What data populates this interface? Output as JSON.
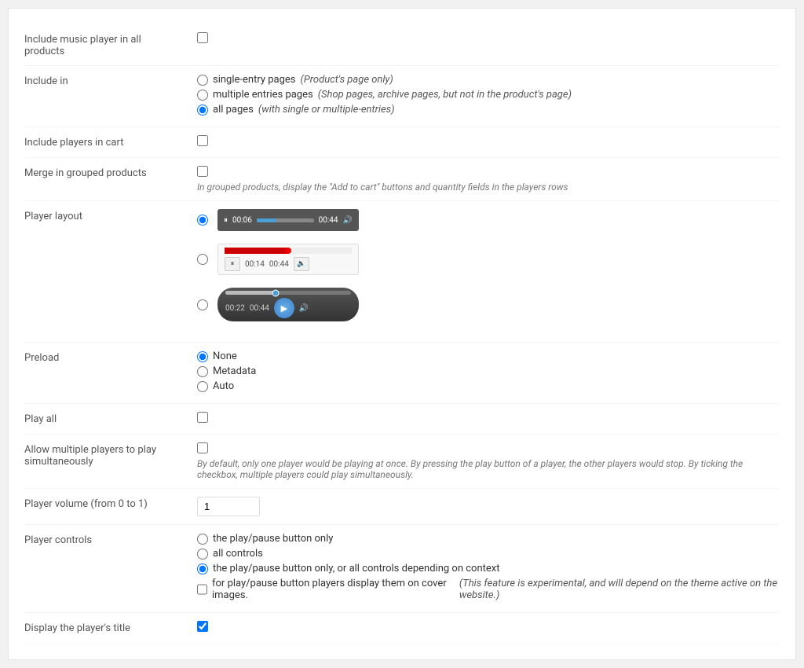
{
  "rows": {
    "include_music_player": {
      "label": "Include music player in all products"
    },
    "include_in": {
      "label": "Include in",
      "options": [
        {
          "id": "single-entry",
          "label": "single-entry pages ",
          "italic": "(Product's page only)",
          "checked": false
        },
        {
          "id": "multiple-entries",
          "label": "multiple entries pages ",
          "italic": "(Shop pages, archive pages, but not in the product's page)",
          "checked": false
        },
        {
          "id": "all-pages",
          "label": "all pages ",
          "italic": "(with single or multiple-entries)",
          "checked": true
        }
      ]
    },
    "include_players_in_cart": {
      "label": "Include players in cart"
    },
    "merge_in_grouped": {
      "label": "Merge in grouped products",
      "hint": "In grouped products, display the \"Add to cart\" buttons and quantity fields in the players rows"
    },
    "player_layout": {
      "label": "Player layout",
      "players": [
        {
          "selected": true,
          "type": "dark-bar",
          "time1": "00:06",
          "time2": "00:44"
        },
        {
          "selected": false,
          "type": "light-bar",
          "time1": "00:14",
          "time2": "00:44"
        },
        {
          "selected": false,
          "type": "rounded-dark",
          "time1": "00:22",
          "time2": "00:44"
        }
      ]
    },
    "preload": {
      "label": "Preload",
      "options": [
        {
          "id": "none",
          "label": "None",
          "checked": true
        },
        {
          "id": "metadata",
          "label": "Metadata",
          "checked": false
        },
        {
          "id": "auto",
          "label": "Auto",
          "checked": false
        }
      ]
    },
    "play_all": {
      "label": "Play all"
    },
    "allow_multiple": {
      "label": "Allow multiple players to play simultaneously",
      "hint": "By default, only one player would be playing at once. By pressing the play button of a player, the other players would stop. By ticking the checkbox, multiple players could play simultaneously."
    },
    "player_volume": {
      "label": "Player volume (from 0 to 1)",
      "value": "1"
    },
    "player_controls": {
      "label": "Player controls",
      "options": [
        {
          "id": "play-pause-only",
          "label": "the play/pause button only",
          "checked": false
        },
        {
          "id": "all-controls",
          "label": "all controls",
          "checked": false
        },
        {
          "id": "play-pause-context",
          "label": "the play/pause button only, or all controls depending on context",
          "checked": true
        }
      ],
      "cover_images_label": "for play/pause button players display them on cover images.",
      "cover_images_italic": "(This feature is experimental, and will depend on the theme active on the website.)"
    },
    "display_title": {
      "label": "Display the player's title"
    }
  }
}
